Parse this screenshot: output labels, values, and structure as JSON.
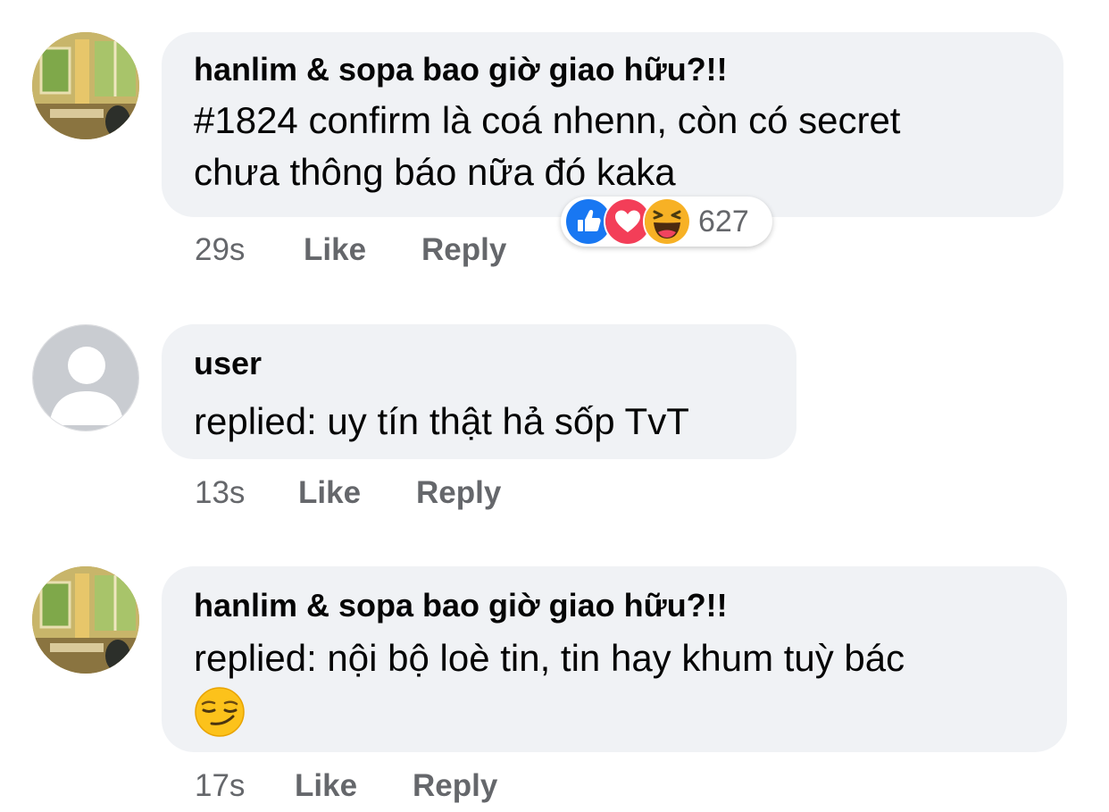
{
  "comments": [
    {
      "author": "hanlim & sopa bao giờ giao hữu?!!",
      "text_line1": "#1824 confirm là coá nhenn, còn có secret",
      "text_line2": "chưa thông báo nữa đó kaka",
      "time": "29s",
      "like_label": "Like",
      "reply_label": "Reply",
      "avatar_icon": "room-window-photo",
      "reactions": {
        "icons": [
          "like-icon",
          "love-icon",
          "haha-icon"
        ],
        "count": "627"
      }
    },
    {
      "author": "user",
      "text_line1": "replied: uy tín thật hả sốp TvT",
      "time": "13s",
      "like_label": "Like",
      "reply_label": "Reply",
      "avatar_icon": "default-user-avatar"
    },
    {
      "author": "hanlim & sopa bao giờ giao hữu?!!",
      "text_line1": "replied: nội bộ loè tin, tin hay khum tuỳ bác",
      "emoji_icon": "smirk-emoji",
      "time": "17s",
      "like_label": "Like",
      "reply_label": "Reply",
      "avatar_icon": "room-window-photo"
    }
  ],
  "colors": {
    "bubble_bg": "#f0f2f5",
    "meta_text": "#65676b",
    "like_blue": "#1877f2",
    "love_red": "#f33e58",
    "haha_yellow": "#f7b125"
  }
}
